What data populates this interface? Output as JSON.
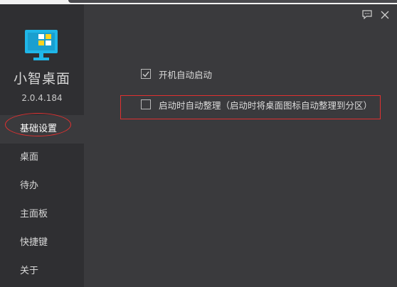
{
  "app": {
    "name": "小智桌面",
    "version": "2.0.4.184"
  },
  "titlebar": {
    "feedback_icon": "chat-bubble-icon",
    "close_icon": "close-icon"
  },
  "sidebar": {
    "items": [
      {
        "label": "基础设置",
        "active": true
      },
      {
        "label": "桌面",
        "active": false
      },
      {
        "label": "待办",
        "active": false
      },
      {
        "label": "主面板",
        "active": false
      },
      {
        "label": "快捷键",
        "active": false
      },
      {
        "label": "关于",
        "active": false
      }
    ]
  },
  "settings": {
    "options": [
      {
        "label": "开机自动启动",
        "checked": true
      },
      {
        "label": "启动时自动整理（启动时将桌面图标自动整理到分区）",
        "checked": false
      }
    ]
  },
  "colors": {
    "logo_blue": "#1fb6e8",
    "logo_yellow": "#ffd21f",
    "highlight_red": "#e03030"
  }
}
